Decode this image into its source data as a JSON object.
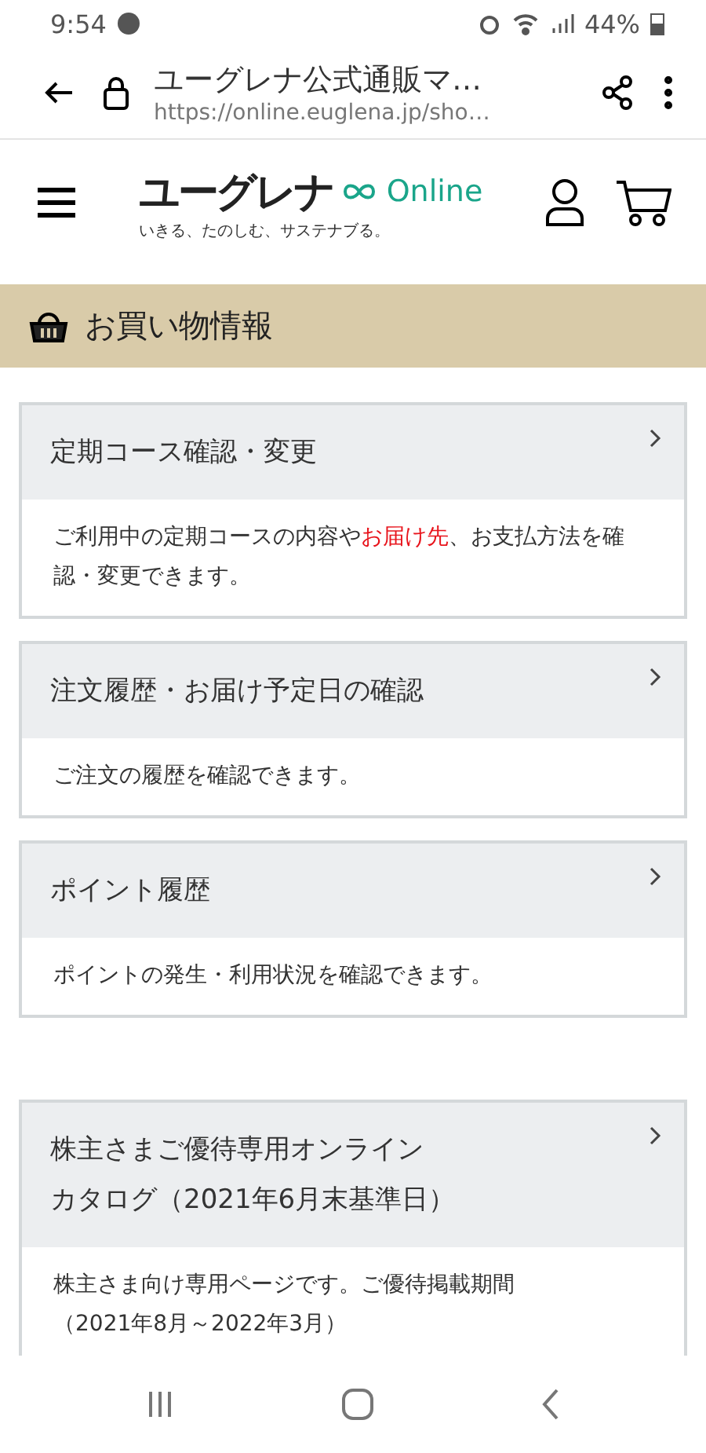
{
  "status_bar": {
    "time": "9:54",
    "battery": "44%"
  },
  "browser": {
    "title": "ユーグレナ公式通販マ…",
    "url": "https://online.euglena.jp/sho…"
  },
  "header": {
    "logo": "ユーグレナ",
    "logo_suffix": "Online",
    "tagline": "いきる、たのしむ、サステナブる。"
  },
  "section": {
    "title": "お買い物情報"
  },
  "cards": [
    {
      "title": [
        "定期コース確認・変更"
      ],
      "description": [
        [
          {
            "text": "ご利用中の定期コースの内容や",
            "highlight": false
          },
          {
            "text": "お届け先",
            "highlight": true
          },
          {
            "text": "、お支払方法を確認・変更できます。",
            "highlight": false
          }
        ]
      ]
    },
    {
      "title": [
        "注文履歴・お届け予定日の確認"
      ],
      "description": [
        [
          {
            "text": "ご注文の履歴を確認できます。",
            "highlight": false
          }
        ]
      ]
    },
    {
      "title": [
        "ポイント履歴"
      ],
      "description": [
        [
          {
            "text": "ポイントの発生・利用状況を確認できます。",
            "highlight": false
          }
        ]
      ]
    }
  ],
  "shareholder_cards": [
    {
      "title": [
        "株主さまご優待専用オンライン",
        "カタログ（2021年6月末基準日）"
      ],
      "description": [
        [
          {
            "text": "株主さま向け専用ページです。ご優待掲載期間",
            "highlight": false
          }
        ],
        [
          {
            "text": "（2021年8月～2022年3月）",
            "highlight": false
          }
        ]
      ]
    }
  ]
}
